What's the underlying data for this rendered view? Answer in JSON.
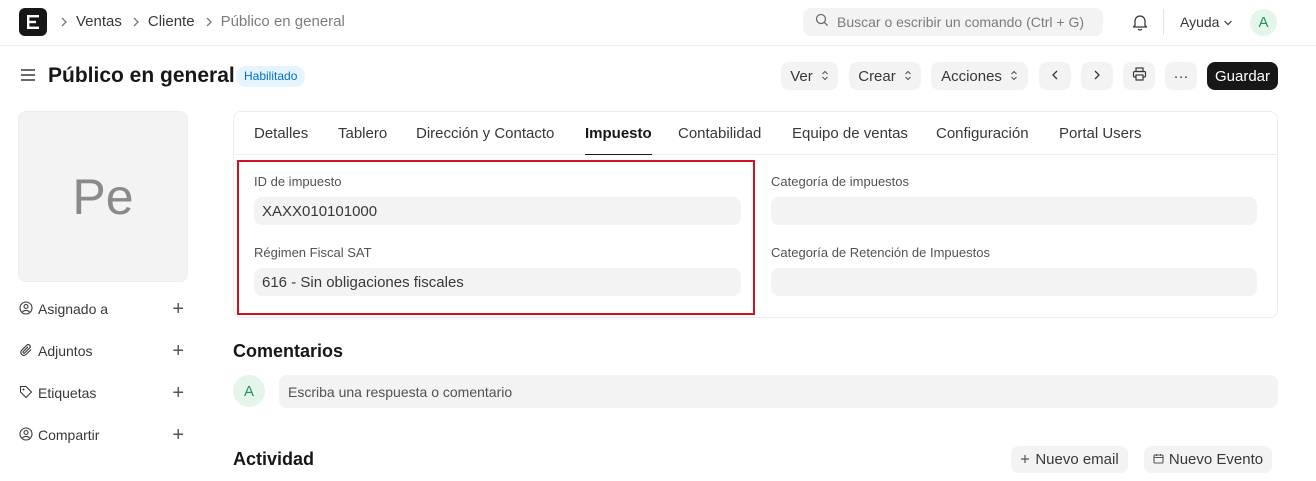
{
  "navbar": {
    "logo_letter": "E",
    "breadcrumbs": [
      "Ventas",
      "Cliente",
      "Público en general"
    ],
    "search_placeholder": "Buscar o escribir un comando (Ctrl + G)",
    "help_label": "Ayuda",
    "user_initial": "A"
  },
  "page": {
    "title": "Público en general",
    "status_badge": "Habilitado",
    "buttons": {
      "view": "Ver",
      "create": "Crear",
      "actions": "Acciones",
      "more": "···",
      "save": "Guardar"
    }
  },
  "sidebar": {
    "image_initials": "Pe",
    "items": [
      {
        "label": "Asignado a",
        "icon": "user-plus-icon"
      },
      {
        "label": "Adjuntos",
        "icon": "paperclip-icon"
      },
      {
        "label": "Etiquetas",
        "icon": "tag-icon"
      },
      {
        "label": "Compartir",
        "icon": "share-user-icon"
      }
    ]
  },
  "tabs": [
    "Detalles",
    "Tablero",
    "Dirección y Contacto",
    "Impuesto",
    "Contabilidad",
    "Equipo de ventas",
    "Configuración",
    "Portal Users"
  ],
  "active_tab": "Impuesto",
  "form": {
    "tax_id_label": "ID de impuesto",
    "tax_id_value": "XAXX010101000",
    "fiscal_regime_label": "Régimen Fiscal SAT",
    "fiscal_regime_value": "616 - Sin obligaciones fiscales",
    "tax_category_label": "Categoría de impuestos",
    "tax_category_value": "",
    "withholding_category_label": "Categoría de Retención de Impuestos",
    "withholding_category_value": ""
  },
  "comments": {
    "title": "Comentarios",
    "user_initial": "A",
    "placeholder": "Escriba una respuesta o comentario"
  },
  "activity": {
    "title": "Actividad",
    "new_email": "Nuevo email",
    "new_event": "Nuevo Evento"
  },
  "colors": {
    "highlight_border": "#d0131f",
    "badge_bg": "#e6f4ff",
    "badge_text": "#0070cc",
    "avatar_bg": "#e4f5e9",
    "avatar_text": "#278f5e",
    "primary_button": "#171717"
  }
}
